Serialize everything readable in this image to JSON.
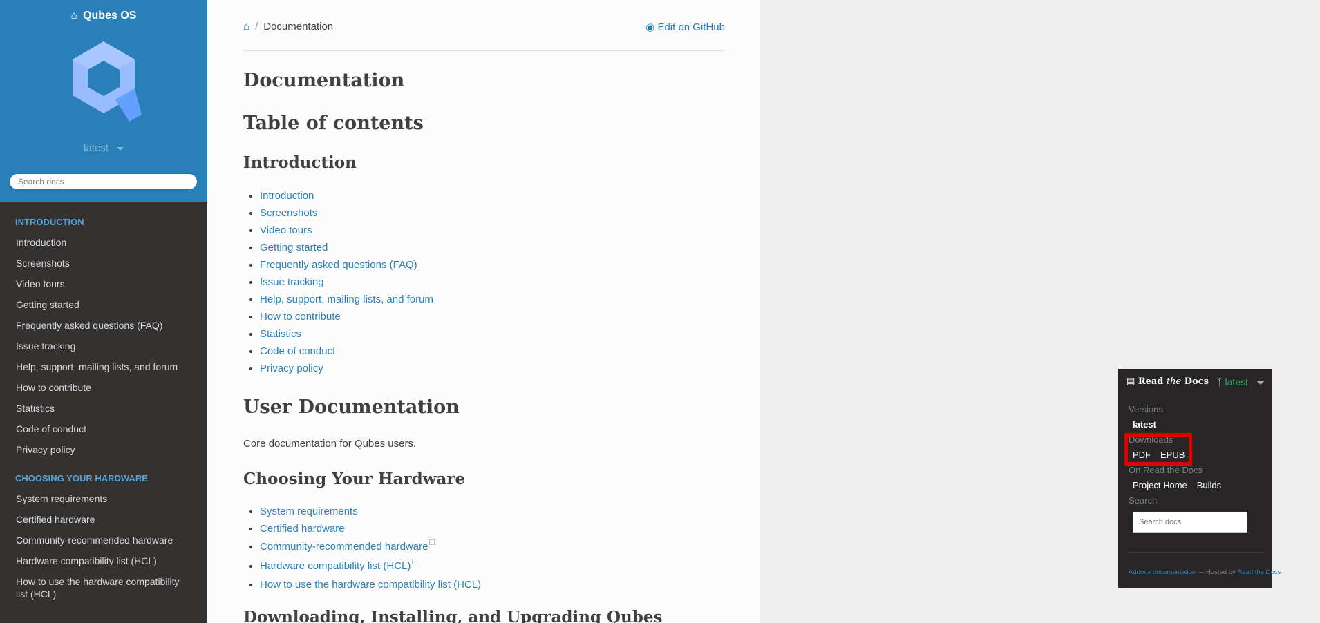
{
  "sidebar": {
    "brand": "Qubes OS",
    "version": "latest",
    "search_placeholder": "Search docs",
    "sections": [
      {
        "caption": "INTRODUCTION",
        "items": [
          "Introduction",
          "Screenshots",
          "Video tours",
          "Getting started",
          "Frequently asked questions (FAQ)",
          "Issue tracking",
          "Help, support, mailing lists, and forum",
          "How to contribute",
          "Statistics",
          "Code of conduct",
          "Privacy policy"
        ]
      },
      {
        "caption": "CHOOSING YOUR HARDWARE",
        "items": [
          "System requirements",
          "Certified hardware",
          "Community-recommended hardware",
          "Hardware compatibility list (HCL)",
          "How to use the hardware compatibility list (HCL)"
        ]
      }
    ]
  },
  "breadcrumb": {
    "current": "Documentation",
    "edit_label": "Edit on GitHub"
  },
  "content": {
    "title": "Documentation",
    "toc_heading": "Table of contents",
    "intro_heading": "Introduction",
    "intro_links": [
      "Introduction",
      "Screenshots",
      "Video tours",
      "Getting started",
      "Frequently asked questions (FAQ)",
      "Issue tracking",
      "Help, support, mailing lists, and forum",
      "How to contribute",
      "Statistics",
      "Code of conduct",
      "Privacy policy"
    ],
    "user_doc_heading": "User Documentation",
    "user_doc_text": "Core documentation for Qubes users.",
    "hardware_heading": "Choosing Your Hardware",
    "hardware_links": [
      {
        "label": "System requirements",
        "external": false
      },
      {
        "label": "Certified hardware",
        "external": false
      },
      {
        "label": "Community-recommended hardware",
        "external": true
      },
      {
        "label": "Hardware compatibility list (HCL)",
        "external": true
      },
      {
        "label": "How to use the hardware compatibility list (HCL)",
        "external": false
      }
    ],
    "next_heading": "Downloading, Installing, and Upgrading Qubes"
  },
  "rtd": {
    "logo_text_a": "Read ",
    "logo_text_b": "the",
    "logo_text_c": " Docs",
    "branch": "latest",
    "versions_label": "Versions",
    "versions": [
      "latest"
    ],
    "downloads_label": "Downloads",
    "downloads": [
      "PDF",
      "EPUB"
    ],
    "on_rtd_label": "On Read the Docs",
    "on_rtd_links": [
      "Project Home",
      "Builds"
    ],
    "search_label": "Search",
    "search_placeholder": "Search docs",
    "footer_link1": "Addons documentation",
    "footer_mid": " — Hosted by ",
    "footer_link2": "Read the Docs"
  },
  "colors": {
    "sidebar_top": "#2980b9",
    "sidebar_bg": "#343131",
    "link": "#2980b9",
    "highlight": "#e00000",
    "rtd_bg": "#272525",
    "rtd_branch": "#27ae60"
  }
}
